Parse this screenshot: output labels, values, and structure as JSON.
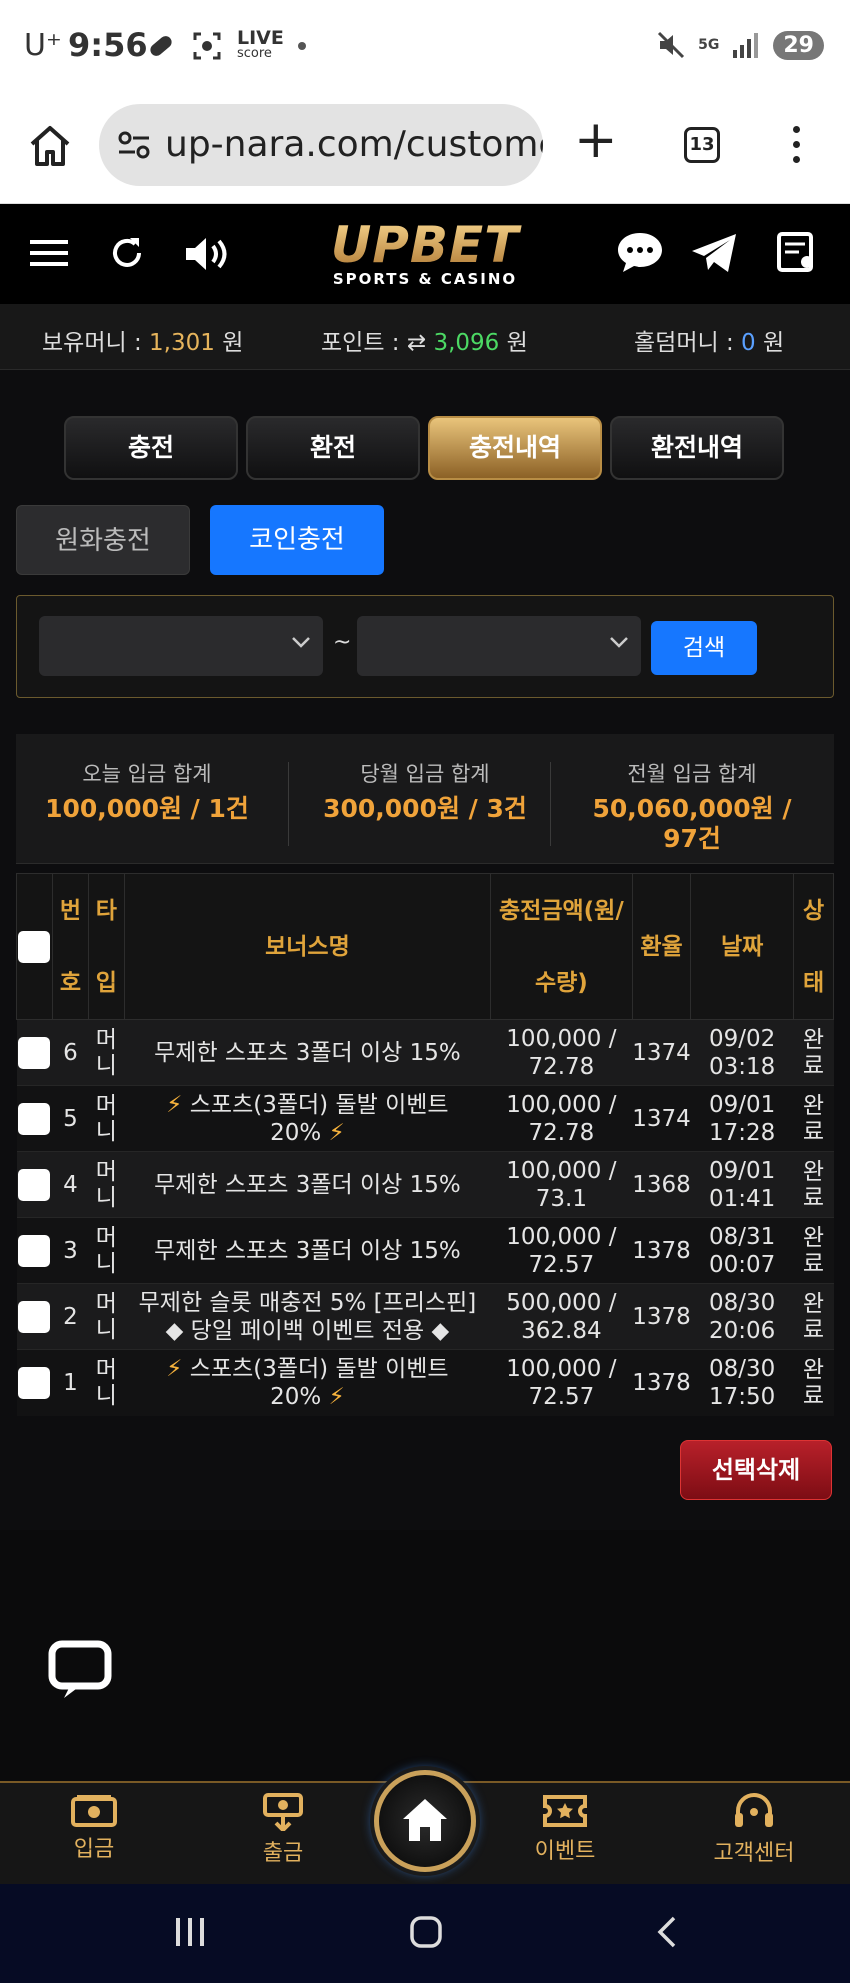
{
  "status_bar": {
    "carrier": "U⁺",
    "time": "9:56",
    "live_label": "LIVE",
    "live_sub": "score",
    "network": "5G",
    "battery": "29"
  },
  "browser": {
    "url": "up-nara.com/customer",
    "tab_count": "13"
  },
  "site": {
    "brand": "UPBET",
    "tagline": "SPORTS & CASINO"
  },
  "balances": {
    "money_label": "보유머니 :",
    "money_value": "1,301",
    "point_label": "포인트 :",
    "point_value": "3,096",
    "holdem_label": "홀덤머니 :",
    "holdem_value": "0",
    "unit": "원"
  },
  "tabs": [
    "충전",
    "환전",
    "충전내역",
    "환전내역"
  ],
  "active_tab": "충전내역",
  "subtabs": [
    "원화충전",
    "코인충전"
  ],
  "search": {
    "tilde": "~",
    "button_label": "검색"
  },
  "summaries": [
    {
      "label": "오늘 입금 합계",
      "value": "100,000원 / 1건"
    },
    {
      "label": "당월 입금 합계",
      "value": "300,000원 / 3건"
    },
    {
      "label": "전월 입금 합계",
      "value": "50,060,000원 / 97건"
    }
  ],
  "table": {
    "headers": {
      "no_1": "번",
      "no_2": "호",
      "type_1": "타",
      "type_2": "입",
      "bonus": "보너스명",
      "amount_1": "충전금액(원/",
      "amount_2": "수량)",
      "rate": "환율",
      "date": "날짜",
      "status_1": "상",
      "status_2": "태"
    },
    "rows": [
      {
        "no": "6",
        "type": "머니",
        "bonus": "무제한 스포츠 3폴더 이상 15%",
        "bonus2": "",
        "bolt": false,
        "amount": "100,000 /",
        "qty": "72.78",
        "rate": "1374",
        "date": "09/02",
        "time": "03:18",
        "status": "완료"
      },
      {
        "no": "5",
        "type": "머니",
        "bonus": "스포츠(3폴더) 돌발 이벤트",
        "bonus2": "20%",
        "bolt": true,
        "amount": "100,000 /",
        "qty": "72.78",
        "rate": "1374",
        "date": "09/01",
        "time": "17:28",
        "status": "완료"
      },
      {
        "no": "4",
        "type": "머니",
        "bonus": "무제한 스포츠 3폴더 이상 15%",
        "bonus2": "",
        "bolt": false,
        "amount": "100,000 /",
        "qty": "73.1",
        "rate": "1368",
        "date": "09/01",
        "time": "01:41",
        "status": "완료"
      },
      {
        "no": "3",
        "type": "머니",
        "bonus": "무제한 스포츠 3폴더 이상 15%",
        "bonus2": "",
        "bolt": false,
        "amount": "100,000 /",
        "qty": "72.57",
        "rate": "1378",
        "date": "08/31",
        "time": "00:07",
        "status": "완료"
      },
      {
        "no": "2",
        "type": "머니",
        "bonus": "무제한 슬롯 매충전 5% [프리스핀]",
        "bonus2": "◆ 당일 페이백 이벤트 전용 ◆",
        "bolt": false,
        "amount": "500,000 /",
        "qty": "362.84",
        "rate": "1378",
        "date": "08/30",
        "time": "20:06",
        "status": "완료"
      },
      {
        "no": "1",
        "type": "머니",
        "bonus": "스포츠(3폴더) 돌발 이벤트",
        "bonus2": "20%",
        "bolt": true,
        "amount": "100,000 /",
        "qty": "72.57",
        "rate": "1378",
        "date": "08/30",
        "time": "17:50",
        "status": "완료"
      }
    ],
    "bolt_glyph": "⚡"
  },
  "delete_button": "선택삭제",
  "bottom_nav": {
    "deposit": "입금",
    "withdraw": "출금",
    "event": "이벤트",
    "support": "고객센터"
  },
  "colors": {
    "gold": "#e6b45c",
    "blue": "#1677ff",
    "red": "#b8202a",
    "background": "#0b0b0c"
  }
}
